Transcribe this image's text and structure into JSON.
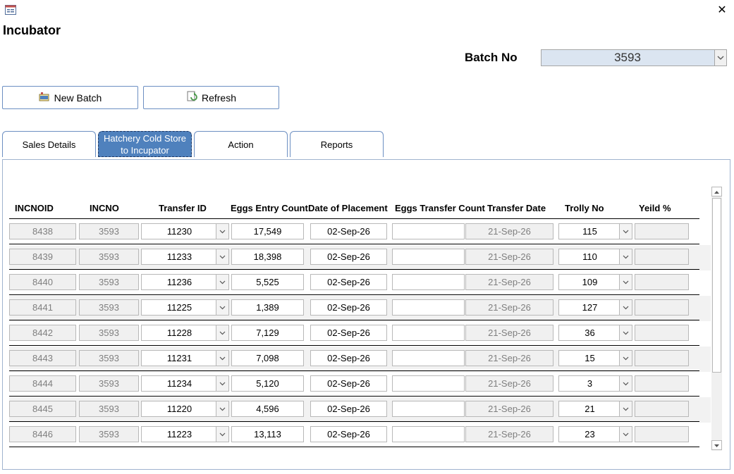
{
  "form": {
    "title": "Incubator"
  },
  "window": {
    "close_glyph": "✕"
  },
  "batch": {
    "label": "Batch No",
    "value": "3593"
  },
  "buttons": {
    "new_batch": "New Batch",
    "refresh": "Refresh"
  },
  "tabs": [
    {
      "label": "Sales Details"
    },
    {
      "label": "Hatchery Cold Store to Incupator"
    },
    {
      "label": "Action"
    },
    {
      "label": "Reports"
    }
  ],
  "active_tab": 1,
  "table": {
    "headers": [
      "INCNOID",
      "INCNO",
      "Transfer ID",
      "Eggs Entry Count",
      "Date of Placement",
      "Eggs Transfer Count",
      "Transfer Date",
      "Trolly No",
      "Yeild %"
    ],
    "rows": [
      {
        "incnoid": "8438",
        "incno": "3593",
        "transfer_id": "11230",
        "eggs_entry": "17,549",
        "placement": "02-Sep-26",
        "eggs_transfer": "",
        "transfer_date": "21-Sep-26",
        "trolly": "115",
        "yield": ""
      },
      {
        "incnoid": "8439",
        "incno": "3593",
        "transfer_id": "11233",
        "eggs_entry": "18,398",
        "placement": "02-Sep-26",
        "eggs_transfer": "",
        "transfer_date": "21-Sep-26",
        "trolly": "110",
        "yield": ""
      },
      {
        "incnoid": "8440",
        "incno": "3593",
        "transfer_id": "11236",
        "eggs_entry": "5,525",
        "placement": "02-Sep-26",
        "eggs_transfer": "",
        "transfer_date": "21-Sep-26",
        "trolly": "109",
        "yield": ""
      },
      {
        "incnoid": "8441",
        "incno": "3593",
        "transfer_id": "11225",
        "eggs_entry": "1,389",
        "placement": "02-Sep-26",
        "eggs_transfer": "",
        "transfer_date": "21-Sep-26",
        "trolly": "127",
        "yield": ""
      },
      {
        "incnoid": "8442",
        "incno": "3593",
        "transfer_id": "11228",
        "eggs_entry": "7,129",
        "placement": "02-Sep-26",
        "eggs_transfer": "",
        "transfer_date": "21-Sep-26",
        "trolly": "36",
        "yield": ""
      },
      {
        "incnoid": "8443",
        "incno": "3593",
        "transfer_id": "11231",
        "eggs_entry": "7,098",
        "placement": "02-Sep-26",
        "eggs_transfer": "",
        "transfer_date": "21-Sep-26",
        "trolly": "15",
        "yield": ""
      },
      {
        "incnoid": "8444",
        "incno": "3593",
        "transfer_id": "11234",
        "eggs_entry": "5,120",
        "placement": "02-Sep-26",
        "eggs_transfer": "",
        "transfer_date": "21-Sep-26",
        "trolly": "3",
        "yield": ""
      },
      {
        "incnoid": "8445",
        "incno": "3593",
        "transfer_id": "11220",
        "eggs_entry": "4,596",
        "placement": "02-Sep-26",
        "eggs_transfer": "",
        "transfer_date": "21-Sep-26",
        "trolly": "21",
        "yield": ""
      },
      {
        "incnoid": "8446",
        "incno": "3593",
        "transfer_id": "11223",
        "eggs_entry": "13,113",
        "placement": "02-Sep-26",
        "eggs_transfer": "",
        "transfer_date": "21-Sep-26",
        "trolly": "23",
        "yield": ""
      }
    ]
  },
  "icons": {
    "form": "form-icon",
    "new_batch": "new-batch-icon",
    "refresh": "refresh-icon",
    "combo": "chevron-down-icon"
  },
  "colors": {
    "accent": "#4f81bd",
    "batch_field_bg": "#dbe5f1",
    "readonly_bg": "#f0f0f0",
    "alt_row_bg": "#f2f2f2"
  }
}
